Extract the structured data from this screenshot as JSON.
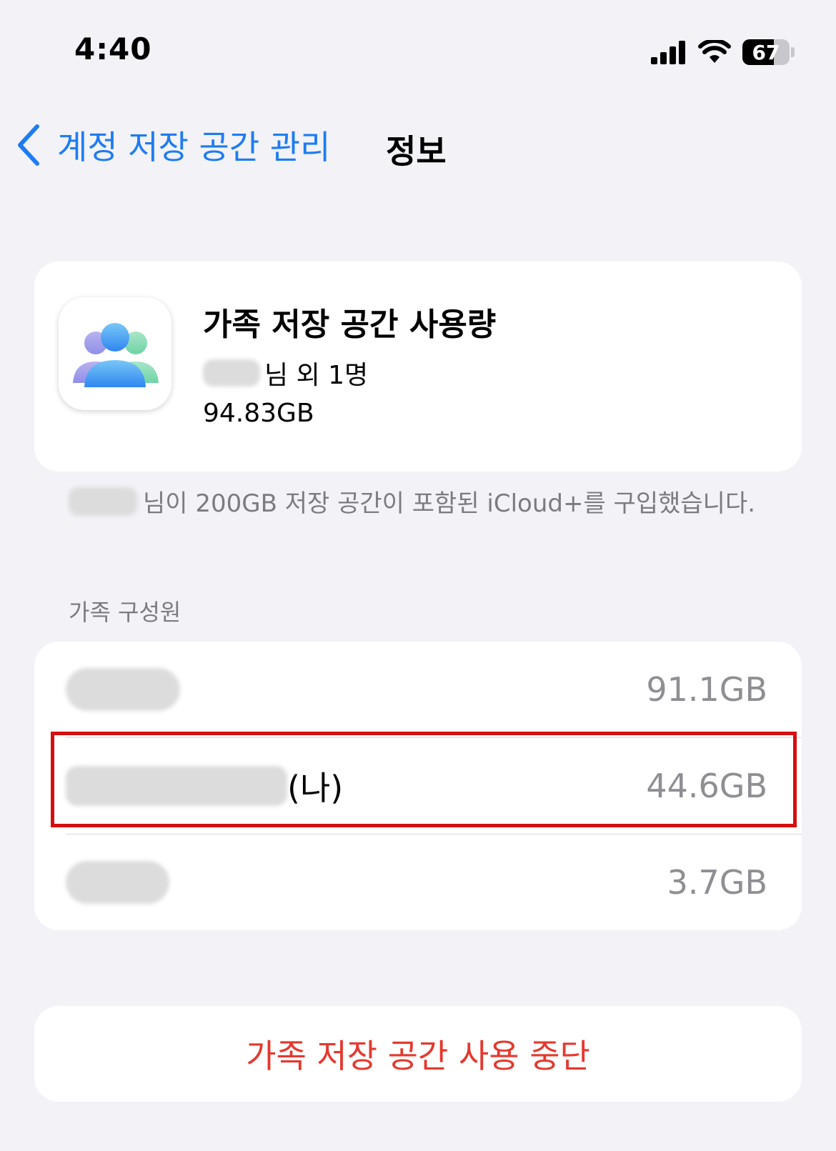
{
  "status_bar": {
    "time": "4:40",
    "battery_level": "67",
    "icons": [
      "cellular-signal-icon",
      "wifi-icon",
      "battery-icon"
    ]
  },
  "nav": {
    "back_label": "계정 저장 공간 관리",
    "title": "정보"
  },
  "header_card": {
    "icon": "family-icon",
    "title": "가족 저장 공간 사용량",
    "subtitle_suffix": "님 외 1명",
    "total_size": "94.83GB"
  },
  "footnote": "님이 200GB 저장 공간이 포함된 iCloud+를 구입했습니다.",
  "members_section": {
    "header": "가족 구성원",
    "members": [
      {
        "name_suffix": "",
        "size": "91.1GB"
      },
      {
        "name_suffix": "(나)",
        "size": "44.6GB"
      },
      {
        "name_suffix": "",
        "size": "3.7GB"
      }
    ]
  },
  "action": {
    "label": "가족 저장 공간 사용 중단"
  },
  "colors": {
    "accent_blue": "#1e7cf2",
    "destructive_red": "#e5382e",
    "highlight_red": "#d50f0f",
    "background": "#f2f2f7"
  }
}
